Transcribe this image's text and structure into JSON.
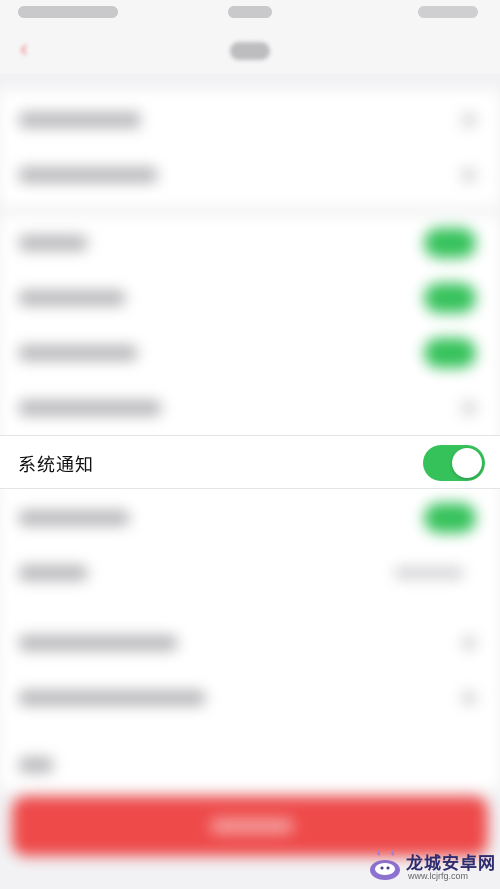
{
  "settings": {
    "focused_row": {
      "label": "系统通知",
      "toggle_on": true
    }
  },
  "colors": {
    "toggle_on": "#36c25b",
    "primary_button": "#ee4a4a",
    "back_arrow": "#f08080"
  },
  "watermark": {
    "brand": "龙城安卓网",
    "url": "www.lcjrfg.com"
  }
}
